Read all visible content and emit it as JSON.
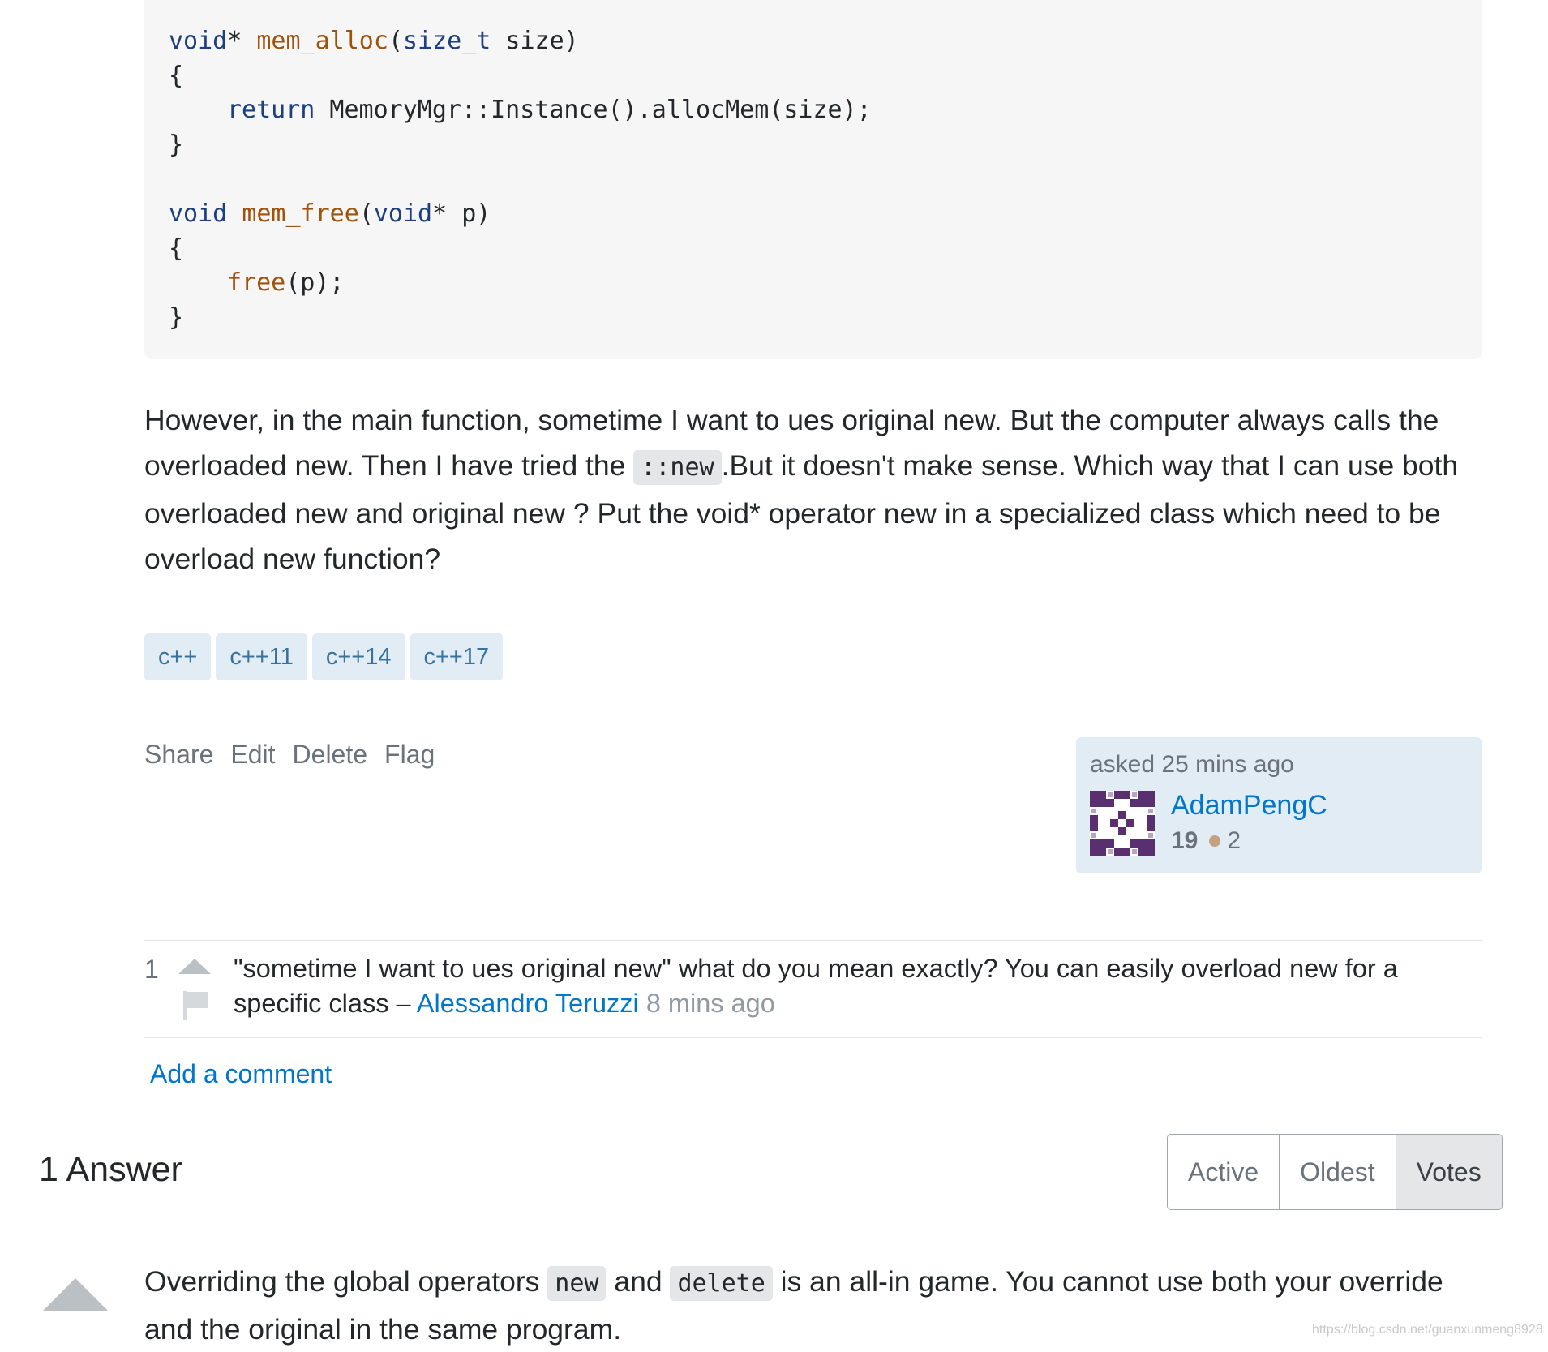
{
  "code": {
    "line1": {
      "kw1": "void",
      "p1": "* ",
      "fn1": "mem_alloc",
      "p2": "(",
      "kw2": "size_t",
      "p3": " size)"
    },
    "line2": "{",
    "line3": {
      "kw": "return",
      "rest": " MemoryMgr::Instance().allocMem(size);"
    },
    "line4": "}",
    "line6": {
      "kw1": "void",
      "fn1": "mem_free",
      "p1": "(",
      "kw2": "void",
      "p2": "* p)"
    },
    "line7": "{",
    "line8": {
      "fn": "free",
      "rest": "(p);"
    },
    "line9": "}"
  },
  "question": {
    "text_part1": "However, in the main function, sometime I want to ues original new. But the computer always calls the overloaded new. Then I have tried the ",
    "inline_code": "::new",
    "text_part2": ".But it doesn't make sense. Which way that I can use both overloaded new and original new ? Put the void* operator new in a specialized class which need to be overload new function?",
    "tags": [
      "c++",
      "c++11",
      "c++14",
      "c++17"
    ],
    "menu": {
      "share": "Share",
      "edit": "Edit",
      "delete": "Delete",
      "flag": "Flag"
    },
    "owner": {
      "asked": "asked 25 mins ago",
      "name": "AdamPengC",
      "reputation": "19",
      "bronze_badges": "2"
    }
  },
  "comment": {
    "score": "1",
    "text": "\"sometime I want to ues original new\" what do you mean exactly? You can easily overload new for a specific class – ",
    "user": "Alessandro Teruzzi",
    "time": "8 mins ago"
  },
  "add_comment": "Add a comment",
  "answers": {
    "title": "1 Answer",
    "sort": {
      "active": "Active",
      "oldest": "Oldest",
      "votes": "Votes"
    },
    "selected_sort": "Votes"
  },
  "answer": {
    "text_part1": "Overriding the global operators ",
    "code1": "new",
    "text_part2": " and ",
    "code2": "delete",
    "text_part3": " is an all-in game. You cannot use both your override and the original in the same program."
  },
  "watermark": "https://blog.csdn.net/guanxunmeng8928"
}
